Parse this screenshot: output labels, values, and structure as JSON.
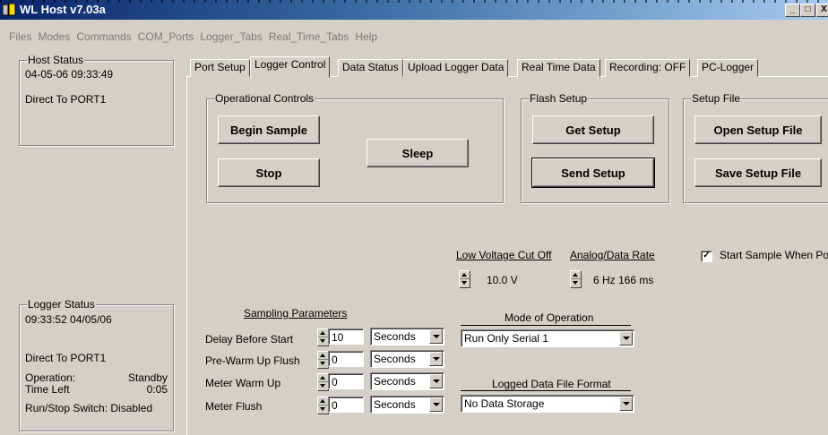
{
  "window": {
    "title": "WL Host v7.03a",
    "controls": {
      "minimize": "_",
      "maximize": "□",
      "close": "X"
    }
  },
  "menu": [
    "Files",
    "Modes",
    "Commands",
    "COM_Ports",
    "Logger_Tabs",
    "Real_Time_Tabs",
    "Help"
  ],
  "host_status": {
    "title": "Host Status",
    "datetime": "04-05-06  09:33:49",
    "connection": "Direct To PORT1"
  },
  "logger_status": {
    "title": "Logger Status",
    "datetime": "09:33:52  04/05/06",
    "connection": "Direct To PORT1",
    "operation_label": "Operation:",
    "operation_value": "Standby",
    "time_left_label": "Time Left",
    "time_left_value": "0:05",
    "run_stop": "Run/Stop Switch: Disabled"
  },
  "tabs": [
    "Port Setup",
    "Logger Control",
    "Data Status",
    "Upload Logger Data",
    "Real Time Data",
    "Recording:  OFF",
    "PC-Logger"
  ],
  "operational_controls": {
    "title": "Operational Controls",
    "begin_sample": "Begin Sample",
    "stop": "Stop",
    "sleep": "Sleep"
  },
  "flash_setup": {
    "title": "Flash Setup",
    "get_setup": "Get Setup",
    "send_setup": "Send Setup"
  },
  "setup_file": {
    "title": "Setup File",
    "open": "Open Setup File",
    "save": "Save Setup File"
  },
  "low_voltage": {
    "label": "Low Voltage Cut Off",
    "value": "10.0 V"
  },
  "analog_rate": {
    "label": "Analog/Data Rate",
    "value": "6 Hz  166 ms"
  },
  "start_when_powered": {
    "label": "Start Sample When Powere",
    "checked": true,
    "mark": "✓"
  },
  "sampling": {
    "title": "Sampling Parameters",
    "rows": [
      {
        "label": "Delay Before Start",
        "value": "10",
        "unit": "Seconds"
      },
      {
        "label": "Pre-Warm Up Flush",
        "value": "0",
        "unit": "Seconds"
      },
      {
        "label": "Meter Warm Up",
        "value": "0",
        "unit": "Seconds"
      },
      {
        "label": "Meter Flush",
        "value": "0",
        "unit": "Seconds"
      }
    ]
  },
  "mode": {
    "title": "Mode of Operation",
    "value": "Run Only Serial 1"
  },
  "file_format": {
    "title": "Logged Data File Format",
    "value": "No Data Storage"
  }
}
